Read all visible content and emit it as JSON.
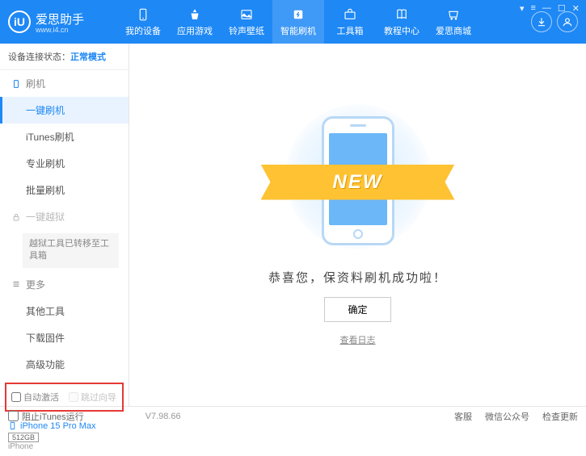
{
  "header": {
    "logo_text": "爱思助手",
    "logo_sub": "www.i4.cn",
    "logo_letter": "iU",
    "nav": [
      {
        "label": "我的设备"
      },
      {
        "label": "应用游戏"
      },
      {
        "label": "铃声壁纸"
      },
      {
        "label": "智能刷机"
      },
      {
        "label": "工具箱"
      },
      {
        "label": "教程中心"
      },
      {
        "label": "爱思商城"
      }
    ]
  },
  "sidebar": {
    "status_label": "设备连接状态：",
    "status_value": "正常模式",
    "group_flash": "刷机",
    "items_flash": [
      "一键刷机",
      "iTunes刷机",
      "专业刷机",
      "批量刷机"
    ],
    "group_jailbreak": "一键越狱",
    "jailbreak_note": "越狱工具已转移至工具箱",
    "group_more": "更多",
    "items_more": [
      "其他工具",
      "下载固件",
      "高级功能"
    ],
    "cb_auto_activate": "自动激活",
    "cb_skip_guide": "跳过向导",
    "device": {
      "name": "iPhone 15 Pro Max",
      "storage": "512GB",
      "type": "iPhone"
    }
  },
  "main": {
    "ribbon": "NEW",
    "success": "恭喜您，保资料刷机成功啦！",
    "ok": "确定",
    "log": "查看日志"
  },
  "footer": {
    "block_itunes": "阻止iTunes运行",
    "version": "V7.98.66",
    "links": [
      "客服",
      "微信公众号",
      "检查更新"
    ]
  }
}
